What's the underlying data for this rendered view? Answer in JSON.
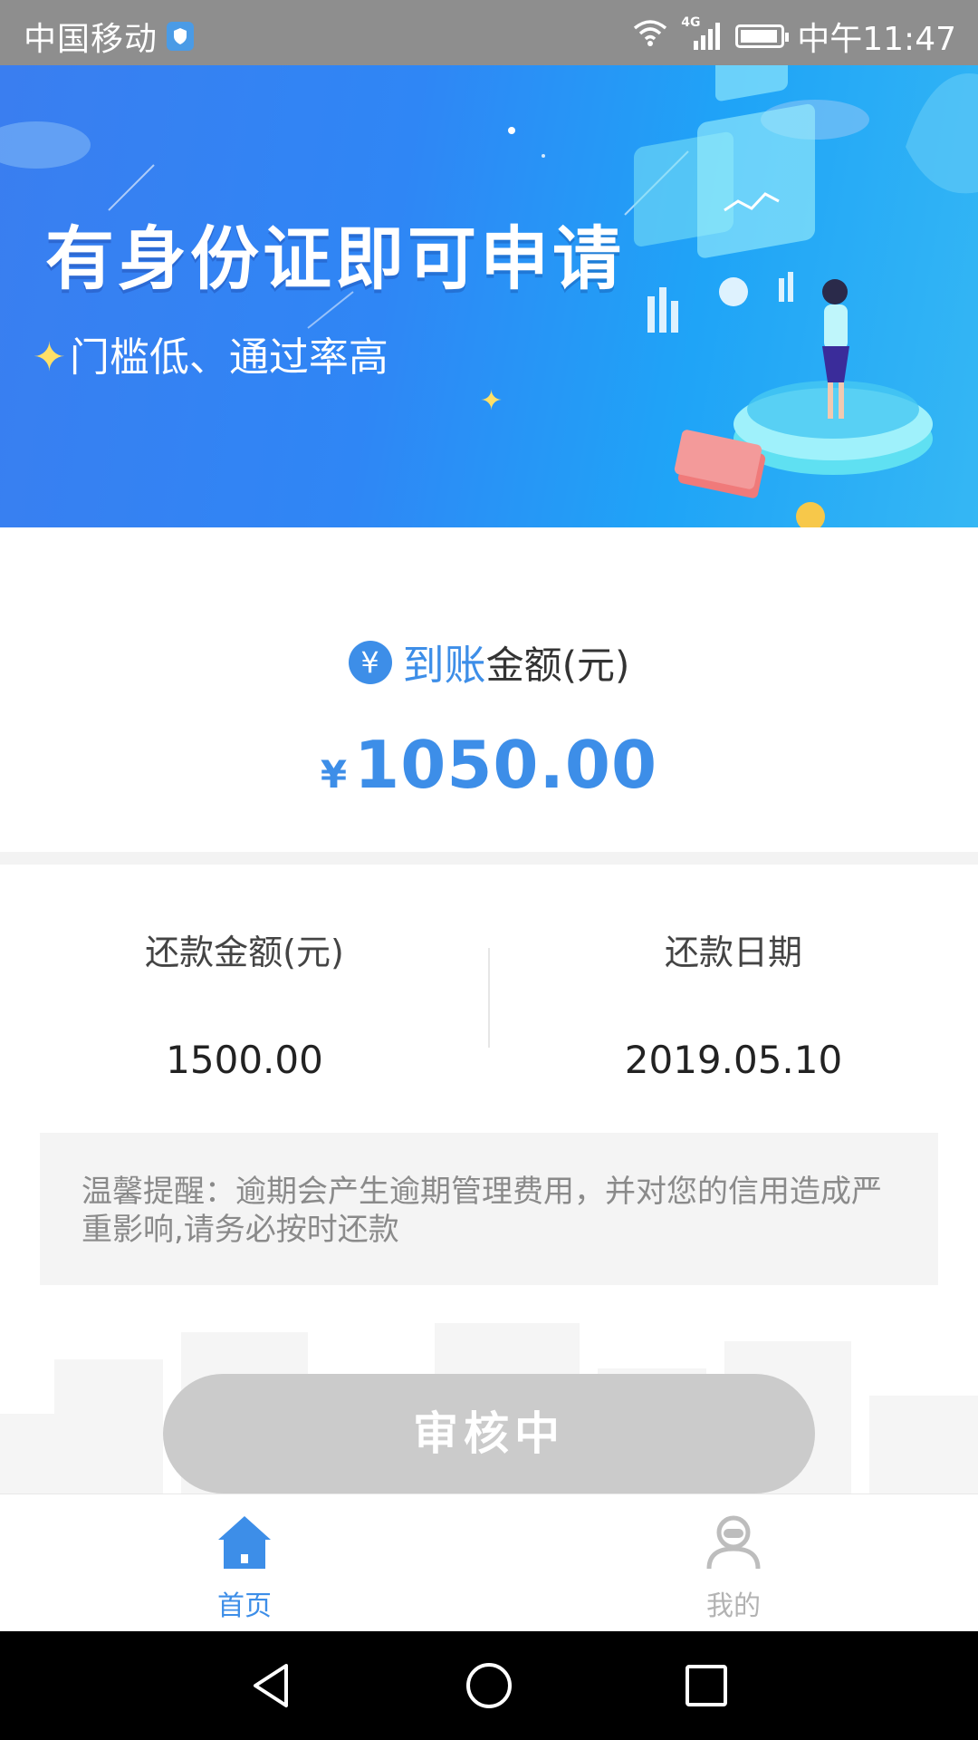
{
  "status_bar": {
    "carrier": "中国移动",
    "network": "4G",
    "time": "中午11:47",
    "battery_level": 0.95
  },
  "banner": {
    "title": "有身份证即可申请",
    "subtitle": "门槛低、通过率高"
  },
  "arrival": {
    "icon": "yen-icon",
    "label_highlight": "到账",
    "label_rest": "金额(元)",
    "currency": "¥",
    "amount": "1050.00"
  },
  "repayment": {
    "amount_label": "还款金额(元)",
    "amount_value": "1500.00",
    "date_label": "还款日期",
    "date_value": "2019.05.10"
  },
  "notice": {
    "text": "温馨提醒：逾期会产生逾期管理费用，并对您的信用造成严重影响,请务必按时还款"
  },
  "action": {
    "button_label": "审核中"
  },
  "tabbar": {
    "items": [
      {
        "label": "首页",
        "icon": "home-icon",
        "active": true
      },
      {
        "label": "我的",
        "icon": "user-icon",
        "active": false
      }
    ]
  },
  "colors": {
    "accent": "#3d8ee8",
    "button_disabled": "#cbcbcb",
    "status_bar": "#8e8e8e"
  }
}
